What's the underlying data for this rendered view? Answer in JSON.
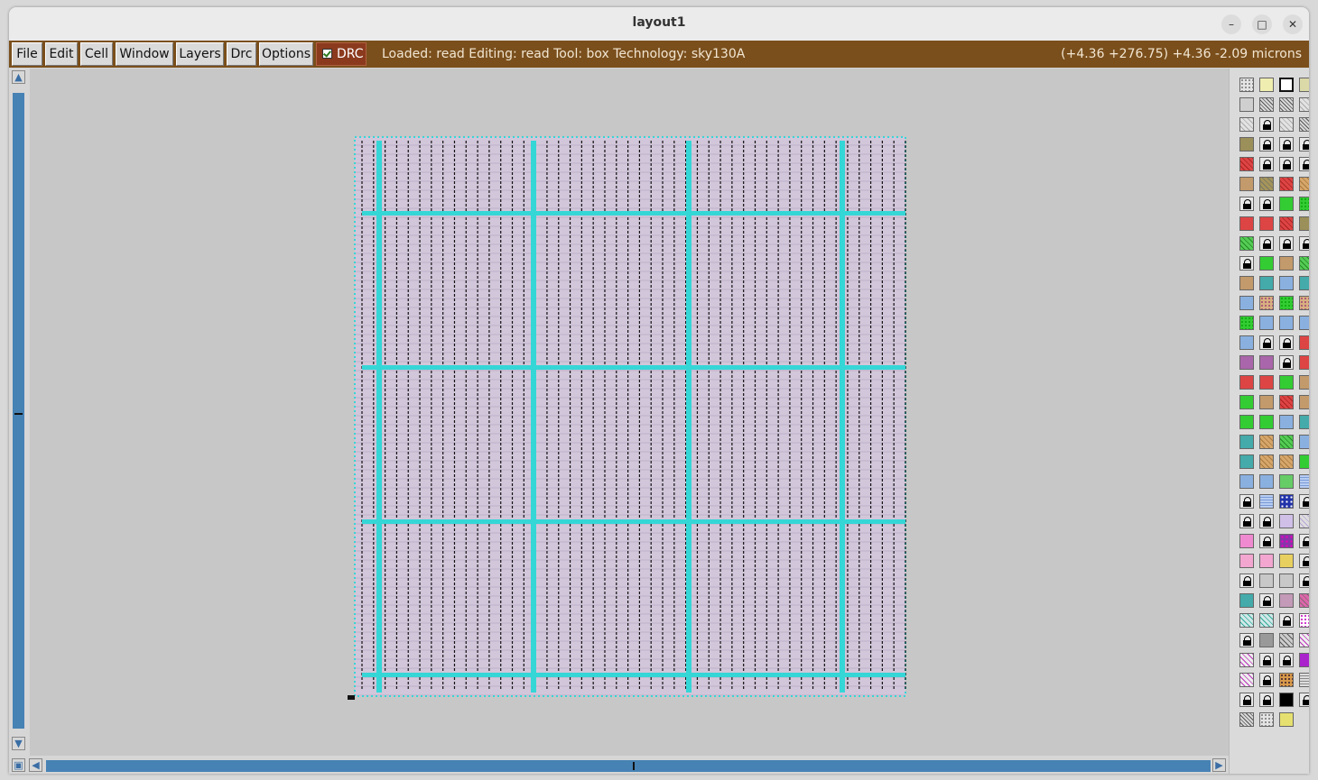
{
  "window": {
    "title": "layout1"
  },
  "window_controls": {
    "minimize": "–",
    "maximize": "□",
    "close": "✕"
  },
  "menu": {
    "items": [
      "File",
      "Edit",
      "Cell",
      "Window",
      "Layers",
      "Drc",
      "Options"
    ]
  },
  "drc_toggle": {
    "label": "DRC",
    "checked": true
  },
  "status": {
    "text": "Loaded: read Editing: read Tool: box  Technology: sky130A",
    "coords": "(+4.36 +276.75) +4.36 -2.09 microns"
  },
  "colors": {
    "menubar": "#7a4f1c",
    "drc_bg": "#8b3a1e",
    "scrollbar": "#4682b4",
    "canvas": "#c7c7c7",
    "cell_fill": "#cfc3d6",
    "power_strap": "#35d6d6"
  },
  "palette": {
    "rows": [
      [
        "dots-gray",
        "pale-yellow",
        "outline-box",
        "pale-olive"
      ],
      [
        "gray",
        "hatch",
        "hatch",
        "hatch-light"
      ],
      [
        "hatch-light",
        "lock",
        "hatch-light",
        "hatch"
      ],
      [
        "olive",
        "lock",
        "lock",
        "lock"
      ],
      [
        "red-hatch",
        "lock",
        "lock",
        "lock"
      ],
      [
        "tan",
        "olive-hatch",
        "red-hatch",
        "tan-hatch"
      ],
      [
        "lock",
        "lock",
        "green",
        "green-dots"
      ],
      [
        "red",
        "red",
        "red-hatch",
        "olive"
      ],
      [
        "green-hatch",
        "lock",
        "lock",
        "lock"
      ],
      [
        "lock",
        "green",
        "tan",
        "green-hatch"
      ],
      [
        "tan",
        "teal-x",
        "blue-x",
        "teal-x"
      ],
      [
        "blue-x",
        "tan-dots",
        "green-dots",
        "tan-dots"
      ],
      [
        "green-dots",
        "blue-x",
        "blue-x",
        "blue-x"
      ],
      [
        "blue-x",
        "lock",
        "lock",
        "red"
      ],
      [
        "purple-x",
        "purple-x",
        "lock",
        "red"
      ],
      [
        "red",
        "red",
        "green",
        "tan"
      ],
      [
        "green",
        "tan",
        "red-hatch",
        "tan"
      ],
      [
        "green",
        "green",
        "blue-x",
        "teal-x"
      ],
      [
        "teal-x",
        "tan-hatch",
        "green-hatch",
        "blue-x"
      ],
      [
        "teal-x",
        "tan-hatch",
        "tan-hatch",
        "green"
      ],
      [
        "blue-x",
        "blue-x",
        "green-x",
        "blue-wave"
      ],
      [
        "lock",
        "blue-wave",
        "navy-pattern",
        "lock"
      ],
      [
        "lock",
        "lock",
        "lavender",
        "lavender-hatch"
      ],
      [
        "pink",
        "lock",
        "purple-pattern",
        "lock"
      ],
      [
        "pink-x",
        "pink-x",
        "yellow-x",
        "lock"
      ],
      [
        "lock",
        "gray-x",
        "gray-x",
        "lock"
      ],
      [
        "teal-x",
        "lock",
        "mauve",
        "mauve-hatch"
      ],
      [
        "teal-hatch",
        "teal-hatch",
        "lock",
        "magenta-dots"
      ],
      [
        "lock",
        "gray-solid",
        "gray-hatch",
        "magenta-hatch"
      ],
      [
        "magenta-hatch",
        "lock",
        "lock",
        "magenta"
      ],
      [
        "magenta-hatch",
        "lock",
        "orange-pattern",
        "gray-wave"
      ],
      [
        "lock",
        "lock",
        "black",
        "lock"
      ],
      [
        "hatch",
        "dots-gray",
        "yellow"
      ]
    ]
  }
}
